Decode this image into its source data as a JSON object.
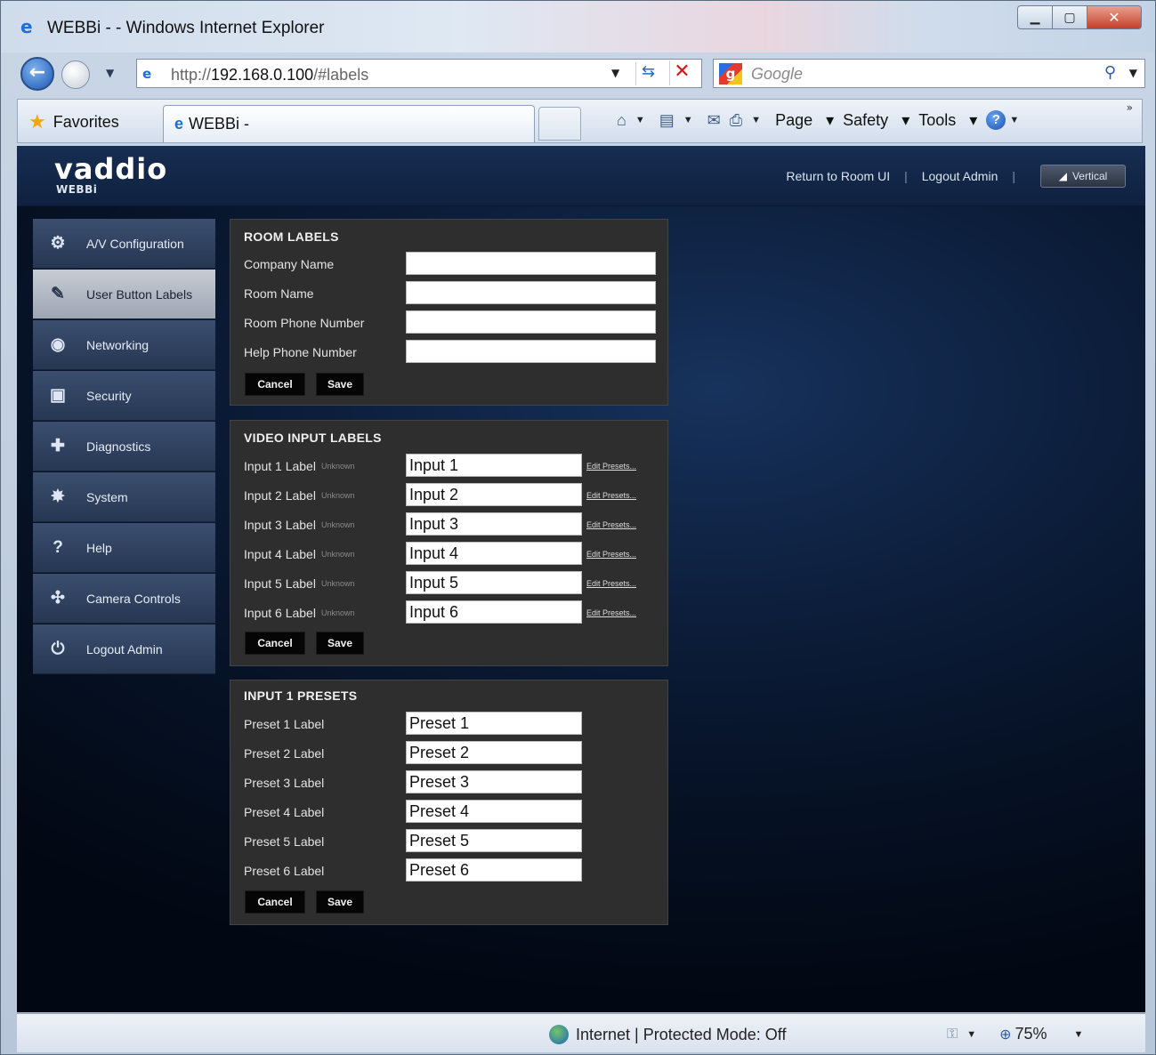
{
  "window": {
    "title": "WEBBi - - Windows Internet Explorer",
    "min_icon": "minimize-icon",
    "max_icon": "maximize-icon",
    "close_icon": "close-icon"
  },
  "addressbar": {
    "url_prefix": "http://",
    "url_host": "192.168.0.100",
    "url_path": "/#labels",
    "search_placeholder": "Google"
  },
  "commandbar": {
    "favorites_label": "Favorites",
    "tab_title": "WEBBi -",
    "page_label": "Page",
    "safety_label": "Safety",
    "tools_label": "Tools"
  },
  "header": {
    "logo": "vaddio",
    "logo_sub": "WEBBi",
    "links": [
      "Return to Room UI",
      "Logout Admin"
    ],
    "vertical_label": "Vertical"
  },
  "sidebar": {
    "items": [
      {
        "label": "A/V Configuration",
        "icon": "av-config-icon",
        "glyph": "⚙"
      },
      {
        "label": "User Button Labels",
        "icon": "pen-icon",
        "glyph": "✎",
        "active": true
      },
      {
        "label": "Networking",
        "icon": "network-icon",
        "glyph": "◉"
      },
      {
        "label": "Security",
        "icon": "lock-icon",
        "glyph": "▣"
      },
      {
        "label": "Diagnostics",
        "icon": "diagnostics-icon",
        "glyph": "✚"
      },
      {
        "label": "System",
        "icon": "system-icon",
        "glyph": "✸"
      },
      {
        "label": "Help",
        "icon": "help-icon",
        "glyph": "?"
      },
      {
        "label": "Camera Controls",
        "icon": "camera-controls-icon",
        "glyph": "✣"
      },
      {
        "label": "Logout Admin",
        "icon": "power-icon",
        "glyph": "⏻"
      }
    ]
  },
  "room_labels": {
    "title": "ROOM LABELS",
    "fields": [
      {
        "label": "Company Name",
        "value": ""
      },
      {
        "label": "Room Name",
        "value": ""
      },
      {
        "label": "Room Phone Number",
        "value": ""
      },
      {
        "label": "Help Phone Number",
        "value": ""
      }
    ],
    "cancel": "Cancel",
    "save": "Save"
  },
  "video_input_labels": {
    "title": "VIDEO INPUT LABELS",
    "unknown_text": "Unknown",
    "edit_link": "Edit Presets...",
    "fields": [
      {
        "label": "Input 1 Label",
        "value": "Input 1"
      },
      {
        "label": "Input 2 Label",
        "value": "Input 2"
      },
      {
        "label": "Input 3 Label",
        "value": "Input 3"
      },
      {
        "label": "Input 4 Label",
        "value": "Input 4"
      },
      {
        "label": "Input 5 Label",
        "value": "Input 5"
      },
      {
        "label": "Input 6 Label",
        "value": "Input 6"
      }
    ],
    "cancel": "Cancel",
    "save": "Save"
  },
  "input1_presets": {
    "title": "INPUT 1 PRESETS",
    "fields": [
      {
        "label": "Preset 1 Label",
        "value": "Preset 1"
      },
      {
        "label": "Preset 2 Label",
        "value": "Preset 2"
      },
      {
        "label": "Preset 3 Label",
        "value": "Preset 3"
      },
      {
        "label": "Preset 4 Label",
        "value": "Preset 4"
      },
      {
        "label": "Preset 5 Label",
        "value": "Preset 5"
      },
      {
        "label": "Preset 6 Label",
        "value": "Preset 6"
      }
    ],
    "cancel": "Cancel",
    "save": "Save"
  },
  "statusbar": {
    "zone": "Internet | Protected Mode: Off",
    "zoom": "75%"
  }
}
